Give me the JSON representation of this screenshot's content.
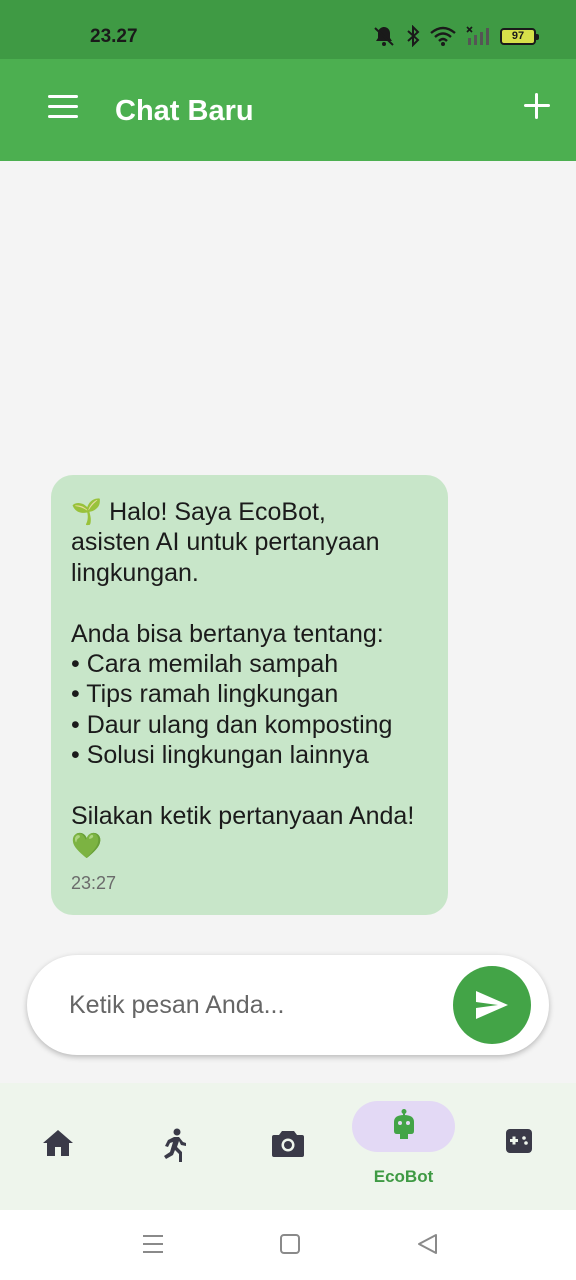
{
  "status_bar": {
    "time": "23.27",
    "battery_level": "97",
    "icons": [
      "mute-icon",
      "bluetooth-icon",
      "wifi-icon",
      "signal-icon",
      "battery-icon"
    ]
  },
  "app_bar": {
    "title": "Chat Baru",
    "menu_icon": "hamburger-menu-icon",
    "add_icon": "plus-icon"
  },
  "chat": {
    "messages": [
      {
        "sender": "bot",
        "text": "🌱 Halo! Saya EcoBot,\nasisten AI untuk pertanyaan\nlingkungan.\n\nAnda bisa bertanya tentang:\n• Cara memilah sampah\n• Tips ramah lingkungan\n• Daur ulang dan komposting\n• Solusi lingkungan lainnya\n\nSilakan ketik pertanyaan Anda!\n💚",
        "time": "23:27"
      }
    ]
  },
  "input": {
    "placeholder": "Ketik pesan Anda...",
    "value": "",
    "send_icon": "send-icon"
  },
  "bottom_nav": {
    "items": [
      {
        "icon": "home-icon",
        "label": ""
      },
      {
        "icon": "running-person-icon",
        "label": ""
      },
      {
        "icon": "camera-icon",
        "label": ""
      },
      {
        "icon": "robot-icon",
        "label": "EcoBot",
        "active": true
      },
      {
        "icon": "game-controller-icon",
        "label": ""
      }
    ]
  },
  "system_nav": {
    "icons": [
      "recent-apps-icon",
      "home-square-icon",
      "back-triangle-icon"
    ]
  },
  "colors": {
    "status_bar": "#3f9a44",
    "app_bar": "#4caf50",
    "bubble": "#c8e6c9",
    "send_button": "#43a447",
    "active_pill": "#e3d9f5",
    "active_label": "#3f9a44"
  }
}
